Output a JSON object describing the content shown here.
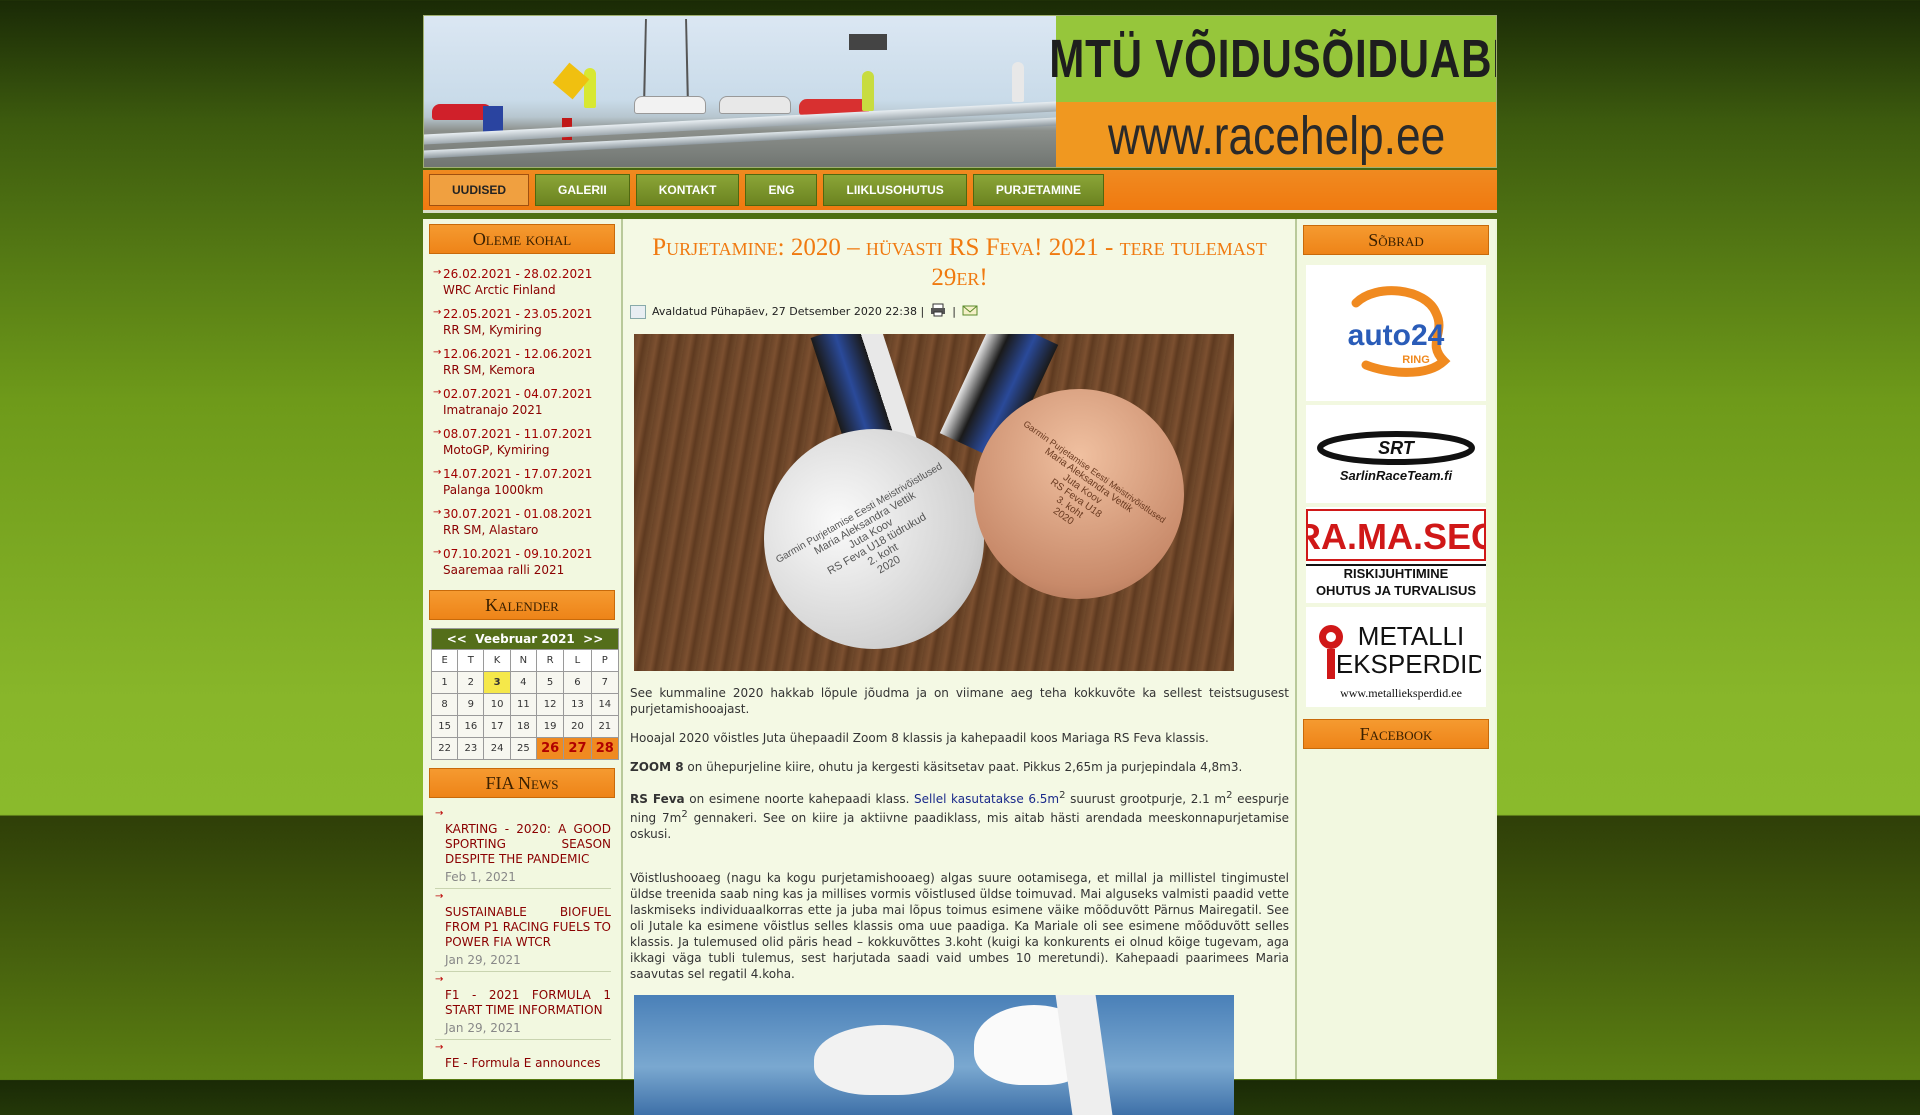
{
  "site": {
    "title_top": "MTÜ VÕIDUSÕIDUABI",
    "title_bottom": "www.racehelp.ee"
  },
  "nav": [
    {
      "label": "UUDISED",
      "active": true
    },
    {
      "label": "GALERII"
    },
    {
      "label": "KONTAKT"
    },
    {
      "label": "ENG"
    },
    {
      "label": "LIIKLUSOHUTUS"
    },
    {
      "label": "PURJETAMINE"
    }
  ],
  "left": {
    "events_title": "Oleme kohal",
    "events": [
      {
        "date": "26.02.2021 - 28.02.2021",
        "name": "WRC Arctic Finland"
      },
      {
        "date": "22.05.2021 - 23.05.2021",
        "name": "RR SM, Kymiring"
      },
      {
        "date": "12.06.2021 - 12.06.2021",
        "name": "RR SM, Kemora"
      },
      {
        "date": "02.07.2021 - 04.07.2021",
        "name": "Imatranajo 2021"
      },
      {
        "date": "08.07.2021 - 11.07.2021",
        "name": "MotoGP, Kymiring"
      },
      {
        "date": "14.07.2021 - 17.07.2021",
        "name": "Palanga 1000km"
      },
      {
        "date": "30.07.2021 - 01.08.2021",
        "name": "RR SM, Alastaro"
      },
      {
        "date": "07.10.2021 - 09.10.2021",
        "name": "Saaremaa ralli 2021"
      }
    ],
    "calendar_title": "Kalender",
    "calendar": {
      "prev": "<<",
      "month": "Veebruar 2021",
      "next": ">>",
      "days": [
        "E",
        "T",
        "K",
        "N",
        "R",
        "L",
        "P"
      ],
      "weeks": [
        [
          "1",
          "2",
          "3",
          "4",
          "5",
          "6",
          "7"
        ],
        [
          "8",
          "9",
          "10",
          "11",
          "12",
          "13",
          "14"
        ],
        [
          "15",
          "16",
          "17",
          "18",
          "19",
          "20",
          "21"
        ],
        [
          "22",
          "23",
          "24",
          "25",
          "26",
          "27",
          "28"
        ]
      ],
      "today": "3",
      "highlighted": [
        "26",
        "27",
        "28"
      ]
    },
    "news_title": "FIA News",
    "news": [
      {
        "title": "KARTING - 2020: A GOOD SPORTING SEASON DESPITE THE PANDEMIC",
        "date": "Feb 1, 2021"
      },
      {
        "title": "SUSTAINABLE BIOFUEL FROM P1 RACING FUELS TO POWER FIA WTCR",
        "date": "Jan 29, 2021"
      },
      {
        "title": "F1 - 2021 FORMULA 1 START TIME INFORMATION",
        "date": "Jan 29, 2021"
      },
      {
        "title": "FE - Formula E announces",
        "date": ""
      }
    ]
  },
  "article": {
    "title": "Purjetamine: 2020 – hüvasti RS Feva! 2021 - tere tulemast 29er!",
    "meta": "Avaldatud Pühapäev, 27 Detsember 2020 22:38 |",
    "meta_sep": "|",
    "medal_text": {
      "silver": [
        "Garmin Purjetamise Eesti Meistrivõistlused",
        "Maria Aleksandra Vettik",
        "Juta Koov",
        "RS Feva U18 tüdrukud",
        "2. koht",
        "2020"
      ],
      "bronze": [
        "Garmin Purjetamise Eesti Meistrivõistlused",
        "Maria Aleksandra Vettik",
        "Juta Koov",
        "RS Feva U18",
        "3. koht",
        "2020"
      ]
    },
    "p1": "See kummaline 2020 hakkab lõpule jõudma ja on viimane aeg teha kokkuvõte ka sellest teistsugusest purjetamishooajast.",
    "p2": "Hooajal 2020 võistles Juta ühepaadil Zoom 8 klassis ja kahepaadil koos Mariaga RS Feva klassis.",
    "p3_b": "ZOOM 8",
    "p3": " on ühepurjeline kiire, ohutu ja kergesti käsitsetav paat. Pikkus 2,65m ja purjepindala 4,8m3.",
    "p4_b": "RS Feva",
    "p4_a": " on esimene noorte kahepaadi klass. ",
    "p4_link": "Sellel kasutatakse 6.5m",
    "p4_c": " suurust grootpurje, 2.1 m",
    "p4_d": " eespurje ning 7m",
    "p4_e": " gennakeri. See on kiire ja aktiivne paadiklass, mis aitab hästi arendada meeskonnapurjetamise oskusi.",
    "sup": "2",
    "p5": "Võistlushooaeg (nagu ka kogu purjetamishooaeg) algas suure ootamisega, et millal ja millistel tingimustel üldse treenida saab ning kas ja millises vormis võistlused üldse toimuvad. Mai alguseks valmisti paadid vette laskmiseks individuaalkorras ette ja juba mai lõpus toimus esimene väike mõõduvõtt Pärnus Mairegatil. See oli Jutale ka esimene võistlus selles klassis oma uue paadiga. Ka Mariale oli see esimene mõõduvõtt selles klassis. Ja tulemused olid päris head – kokkuvõttes 3.koht (kuigi ka konkurents ei olnud kõige tugevam, aga ikkagi väga tubli tulemus, sest harjutada saadi vaid umbes 10 meretundi). Kahepaadi paarimees Maria saavutas sel regatil 4.koha."
  },
  "right": {
    "friends_title": "Sõbrad",
    "sponsors": [
      {
        "name": "auto24",
        "sub": "RING"
      },
      {
        "name": "SRT",
        "sub": "SarlinRaceTeam.fi"
      },
      {
        "name": "RA.MA.SEC",
        "sub1": "RISKIJUHTIMINE",
        "sub2": "OHUTUS JA TURVALISUS"
      },
      {
        "name": "METALLI",
        "name2": "EKSPERDID",
        "sub": "www.metallieksperdid.ee"
      }
    ],
    "facebook_title": "Facebook"
  },
  "colors": {
    "accent": "#f07a10",
    "nav_green": "#7a9428",
    "link_red": "#8a0000"
  }
}
